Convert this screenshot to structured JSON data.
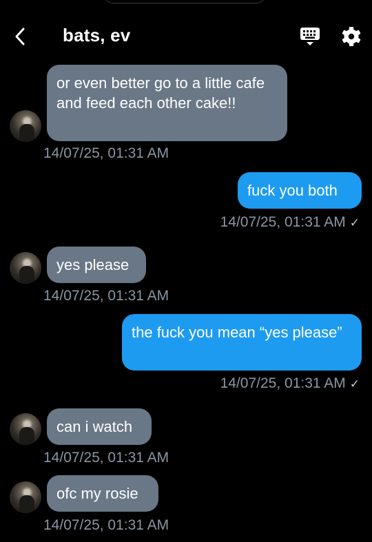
{
  "header": {
    "title": "bats, ev"
  },
  "icons": {
    "back": "chevron-left-icon",
    "keyboard": "keyboard-icon",
    "settings": "gear-icon"
  },
  "colors": {
    "incoming_bubble": "#697786",
    "outgoing_bubble": "#1d9bf0",
    "timestamp": "#8b96a3",
    "background": "#000000"
  },
  "messages": [
    {
      "direction": "in",
      "text": "or even better go to a little cafe and feed each other cake!!",
      "timestamp": "14/07/25, 01:31 AM"
    },
    {
      "direction": "out",
      "text": "fuck you both",
      "timestamp": "14/07/25, 01:31 AM",
      "status": "✓"
    },
    {
      "direction": "in",
      "text": "yes please",
      "timestamp": "14/07/25, 01:31 AM"
    },
    {
      "direction": "out",
      "text": "the fuck you mean “yes please”",
      "timestamp": "14/07/25, 01:31 AM",
      "status": "✓"
    },
    {
      "direction": "in",
      "text": "can i watch",
      "timestamp": "14/07/25, 01:31 AM"
    },
    {
      "direction": "in",
      "text": "ofc my rosie",
      "timestamp": "14/07/25, 01:31 AM"
    }
  ]
}
